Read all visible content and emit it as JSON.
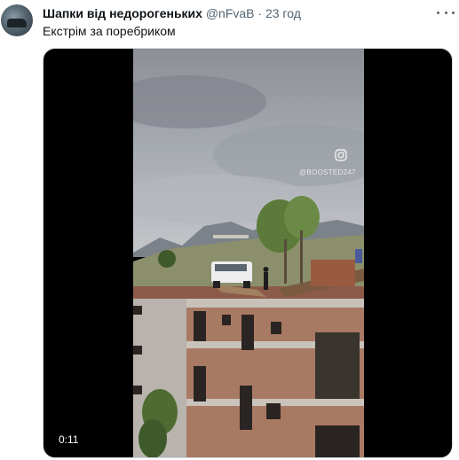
{
  "tweet": {
    "display_name": "Шапки від недорогеньких",
    "handle_time": "@nFvaB · 23 год",
    "text": "Екстрім за поребриком"
  },
  "video": {
    "duration": "0:11",
    "watermark": "@BOOSTED247"
  },
  "icons": [
    "more-icon",
    "instagram-icon"
  ]
}
